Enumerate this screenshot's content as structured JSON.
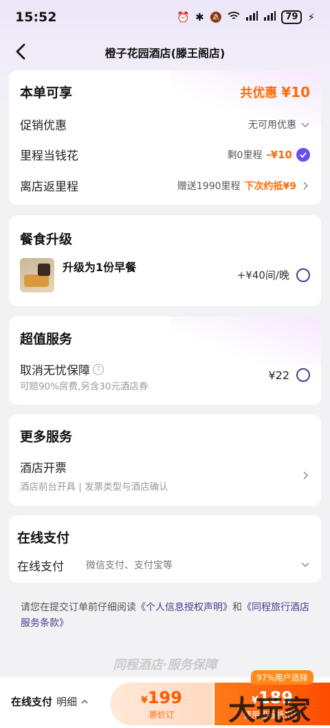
{
  "status": {
    "time": "15:52",
    "battery": "79"
  },
  "nav": {
    "title": "橙子花园酒店(滕王阁店)"
  },
  "discount": {
    "title": "本单可享",
    "total_label": "共优惠",
    "total_value": "¥10",
    "rows": [
      {
        "label": "促销优惠",
        "value": "无可用优惠"
      },
      {
        "label": "里程当钱花",
        "value": "剩0里程",
        "amount": "-¥10"
      },
      {
        "label": "离店返里程",
        "value": "赠送1990里程",
        "extra": "下次约抵¥9"
      }
    ]
  },
  "meal": {
    "title": "餐食升级",
    "item": "升级为1份早餐",
    "price": "+¥40间/晚"
  },
  "value_service": {
    "title": "超值服务",
    "item": "取消无忧保障",
    "desc": "可赔90%房费,另含30元酒店券",
    "price": "¥22"
  },
  "more_service": {
    "title": "更多服务",
    "item": "酒店开票",
    "desc": "酒店前台开具 | 发票类型与酒店确认"
  },
  "payment": {
    "title": "在线支付",
    "label": "在线支付",
    "methods": "微信支付、支付宝等"
  },
  "notice": {
    "prefix": "请您在提交订单前仔细阅读",
    "link1": "《个人信息授权声明》",
    "and": "和",
    "link2": "《同程旅行酒店服务条款》"
  },
  "footer_brand": "同程酒店·服务保障",
  "bottom": {
    "pay_label": "在线支付",
    "detail": "明细",
    "orig_currency": "¥",
    "orig_price": "199",
    "orig_label": "原价订",
    "user_tag": "97%用户选择",
    "submit_currency": "¥",
    "submit_price": "189",
    "submit_label": "使用里程抵扣订"
  },
  "watermark": "大玩家",
  "colors": {
    "accent": "#ff6a00",
    "brand_purple": "#6c4cf5"
  }
}
